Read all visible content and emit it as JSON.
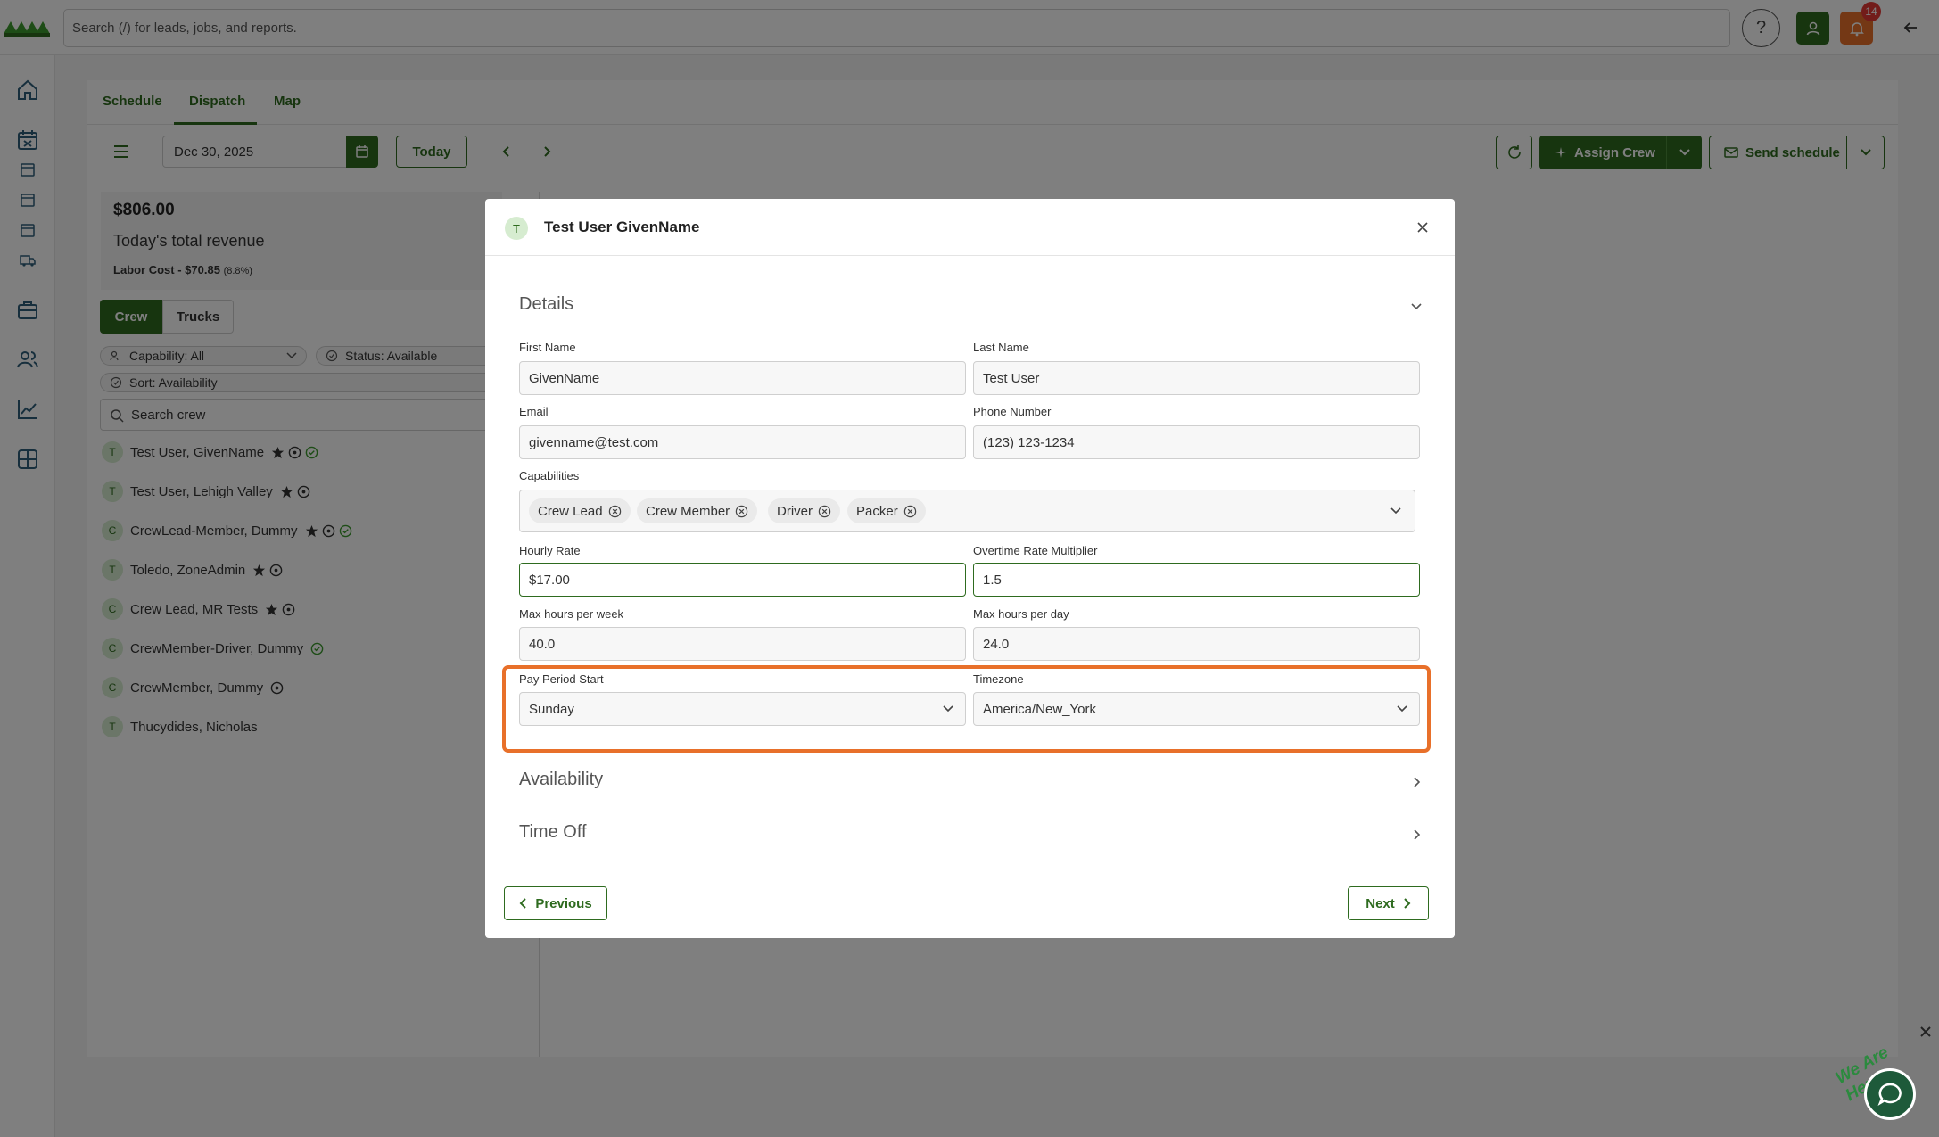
{
  "topbar": {
    "search_placeholder": "Search (/) for leads, jobs, and reports.",
    "help_label": "?",
    "notification_count": "14",
    "accent_color": "#2e6b1f",
    "bell_color": "#e8702a"
  },
  "tabs": [
    {
      "label": "Schedule"
    },
    {
      "label": "Dispatch"
    },
    {
      "label": "Map"
    }
  ],
  "toolbar": {
    "date_value": "Dec 30, 2025",
    "today_label": "Today",
    "assign_crew_label": "Assign Crew",
    "send_schedule_label": "Send schedule"
  },
  "revenue": {
    "amount": "$806.00",
    "label": "Today's total revenue",
    "labor_cost": "Labor Cost - $70.85",
    "labor_pct": "(8.8%)"
  },
  "crew_panel": {
    "seg_crew": "Crew",
    "seg_trucks": "Trucks",
    "filter_capability": "Capability: All",
    "filter_status": "Status: Available",
    "filter_sort": "Sort: Availability",
    "search_placeholder": "Search crew",
    "items": [
      {
        "initial": "T",
        "name": "Test User, GivenName"
      },
      {
        "initial": "T",
        "name": "Test User, Lehigh Valley"
      },
      {
        "initial": "C",
        "name": "CrewLead-Member, Dummy"
      },
      {
        "initial": "T",
        "name": "Toledo, ZoneAdmin"
      },
      {
        "initial": "C",
        "name": "Crew Lead, MR Tests"
      },
      {
        "initial": "C",
        "name": "CrewMember-Driver, Dummy"
      },
      {
        "initial": "C",
        "name": "CrewMember, Dummy"
      },
      {
        "initial": "T",
        "name": "Thucydides, Nicholas"
      }
    ]
  },
  "modal": {
    "avatar_initial": "T",
    "title": "Test User GivenName",
    "details_section": "Details",
    "first_name_label": "First Name",
    "first_name_value": "GivenName",
    "last_name_label": "Last Name",
    "last_name_value": "Test User",
    "email_label": "Email",
    "email_value": "givenname@test.com",
    "phone_label": "Phone Number",
    "phone_value": "(123) 123-1234",
    "capabilities_label": "Capabilities",
    "capabilities": [
      "Crew Lead",
      "Crew Member",
      "Driver",
      "Packer"
    ],
    "hourly_rate_label": "Hourly Rate",
    "hourly_rate_value": "$17.00",
    "overtime_label": "Overtime Rate Multiplier",
    "overtime_value": "1.5",
    "max_week_label": "Max hours per week",
    "max_week_value": "40.0",
    "max_day_label": "Max hours per day",
    "max_day_value": "24.0",
    "pay_period_label": "Pay Period Start",
    "pay_period_value": "Sunday",
    "timezone_label": "Timezone",
    "timezone_value": "America/New_York",
    "availability_section": "Availability",
    "timeoff_section": "Time Off",
    "previous_label": "Previous",
    "next_label": "Next"
  },
  "chat": {
    "tag": "We Are Here!"
  }
}
